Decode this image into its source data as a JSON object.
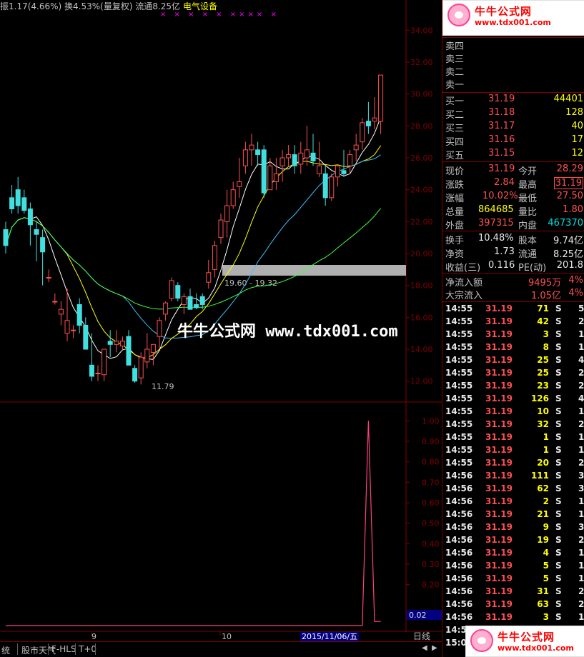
{
  "header": {
    "stats": "振1.17(4.66%) 换4.53%(量复权) 流通8.25亿",
    "sector": "电气设备",
    "markers": "× ×  × ×  × ××××  ×"
  },
  "price_axis": {
    "ticks": [
      "34.00",
      "32.00",
      "30.00",
      "28.00",
      "26.00",
      "24.00",
      "22.00",
      "20.00",
      "18.00",
      "16.00",
      "14.00",
      "12.00"
    ]
  },
  "annotations": {
    "range_label": "19.60 - 19.32",
    "low_label": "11.79"
  },
  "indicator_axis": {
    "ticks": [
      "1.00",
      "0.90",
      "0.80",
      "0.70",
      "0.60",
      "0.50",
      "0.40",
      "0.30",
      "0.20"
    ],
    "current_value": "0.02"
  },
  "time_axis": {
    "labels": [
      "9",
      "10"
    ],
    "cursor_date": "2015/11/06/五",
    "period": "日线"
  },
  "watermark": "牛牛公式网 www.tdx001.com",
  "logo": {
    "title": "牛牛公式网",
    "url": "www.tdx001.com",
    "faded_url": "www.0ogs.com"
  },
  "order_book": {
    "sells": [
      {
        "label": "卖四",
        "price": "",
        "vol": ""
      },
      {
        "label": "卖三",
        "price": "",
        "vol": ""
      },
      {
        "label": "卖二",
        "price": "",
        "vol": ""
      },
      {
        "label": "卖一",
        "price": "",
        "vol": ""
      }
    ],
    "buys": [
      {
        "label": "买一",
        "price": "31.19",
        "vol": "44401"
      },
      {
        "label": "买二",
        "price": "31.18",
        "vol": "128"
      },
      {
        "label": "买三",
        "price": "31.17",
        "vol": "40"
      },
      {
        "label": "买四",
        "price": "31.16",
        "vol": "17"
      },
      {
        "label": "买五",
        "price": "31.15",
        "vol": "12"
      }
    ]
  },
  "quote": {
    "current_label": "现价",
    "current": "31.19",
    "open_label": "今开",
    "open": "28.29",
    "change_label": "涨跌",
    "change": "2.84",
    "high_label": "最高",
    "high": "31.19",
    "pct_label": "涨幅",
    "pct": "10.02%",
    "low_label": "最低",
    "low": "27.50",
    "vol_label": "总量",
    "vol": "864685",
    "ratio_label": "量比",
    "ratio": "1.80",
    "out_label": "外盘",
    "out": "397315",
    "in_label": "内盘",
    "in": "467370",
    "turnover_label": "换手",
    "turnover": "10.48%",
    "capital_label": "股本",
    "capital": "9.74亿",
    "net_asset_label": "净资",
    "net_asset": "1.73",
    "float_label": "流通",
    "float": "8.25亿",
    "eps_label": "收益(三)",
    "eps": "0.116",
    "pe_label": "PE(动)",
    "pe": "201.8",
    "inflow_label": "净流入额",
    "inflow": "9495万",
    "inflow_pct": "4%",
    "block_label": "大宗流入",
    "block": "1.05亿",
    "block_pct": "4%"
  },
  "ticks": [
    {
      "time": "14:55",
      "price": "31.19",
      "vol": "71",
      "side": "S",
      "n": "5"
    },
    {
      "time": "14:55",
      "price": "31.19",
      "vol": "42",
      "side": "S",
      "n": "2"
    },
    {
      "time": "14:55",
      "price": "31.19",
      "vol": "3",
      "side": "S",
      "n": "1"
    },
    {
      "time": "14:55",
      "price": "31.19",
      "vol": "8",
      "side": "S",
      "n": "1"
    },
    {
      "time": "14:55",
      "price": "31.19",
      "vol": "25",
      "side": "S",
      "n": "4"
    },
    {
      "time": "14:55",
      "price": "31.19",
      "vol": "25",
      "side": "S",
      "n": "2"
    },
    {
      "time": "14:55",
      "price": "31.19",
      "vol": "23",
      "side": "S",
      "n": "2"
    },
    {
      "time": "14:55",
      "price": "31.19",
      "vol": "126",
      "side": "S",
      "n": "4"
    },
    {
      "time": "14:55",
      "price": "31.19",
      "vol": "10",
      "side": "S",
      "n": "1"
    },
    {
      "time": "14:55",
      "price": "31.19",
      "vol": "32",
      "side": "S",
      "n": "2"
    },
    {
      "time": "14:55",
      "price": "31.19",
      "vol": "1",
      "side": "S",
      "n": "1"
    },
    {
      "time": "14:55",
      "price": "31.19",
      "vol": "1",
      "side": "S",
      "n": "1"
    },
    {
      "time": "14:55",
      "price": "31.19",
      "vol": "20",
      "side": "S",
      "n": "2"
    },
    {
      "time": "14:56",
      "price": "31.19",
      "vol": "111",
      "side": "S",
      "n": "3"
    },
    {
      "time": "14:56",
      "price": "31.19",
      "vol": "62",
      "side": "S",
      "n": "3"
    },
    {
      "time": "14:56",
      "price": "31.19",
      "vol": "2",
      "side": "S",
      "n": "1"
    },
    {
      "time": "14:56",
      "price": "31.19",
      "vol": "21",
      "side": "S",
      "n": "1"
    },
    {
      "time": "14:56",
      "price": "31.19",
      "vol": "9",
      "side": "S",
      "n": "3"
    },
    {
      "time": "14:56",
      "price": "31.19",
      "vol": "19",
      "side": "S",
      "n": "2"
    },
    {
      "time": "14:56",
      "price": "31.19",
      "vol": "4",
      "side": "S",
      "n": "1"
    },
    {
      "time": "14:56",
      "price": "31.19",
      "vol": "5",
      "side": "S",
      "n": "1"
    },
    {
      "time": "14:56",
      "price": "31.19",
      "vol": "5",
      "side": "S",
      "n": "1"
    },
    {
      "time": "14:56",
      "price": "31.19",
      "vol": "31",
      "side": "S",
      "n": "2"
    },
    {
      "time": "14:56",
      "price": "31.19",
      "vol": "63",
      "side": "S",
      "n": "2"
    },
    {
      "time": "14:56",
      "price": "31.19",
      "vol": "3",
      "side": "S",
      "n": "1"
    },
    {
      "time": "14:5",
      "price": "",
      "vol": "",
      "side": "",
      "n": ""
    },
    {
      "time": "15:0",
      "price": "",
      "vol": "",
      "side": "",
      "n": ""
    }
  ],
  "bottom_tabs": [
    "统",
    "股市天气",
    "F-HLS",
    "T+0"
  ],
  "colors": {
    "up": "#ff5050",
    "down": "#40e0e0",
    "ma5": "#ffffff",
    "ma10": "#ffff00",
    "ma20": "#40c0ff",
    "ma60": "#40ff40",
    "border": "#800000"
  },
  "chart_data": {
    "type": "candlestick",
    "ylim": [
      11,
      35
    ],
    "candles": [
      [
        21.5,
        22.0,
        20.0,
        20.5
      ],
      [
        23.5,
        24.3,
        22.5,
        22.8
      ],
      [
        24.0,
        24.8,
        22.5,
        23.0
      ],
      [
        23.5,
        24.0,
        22.5,
        22.7
      ],
      [
        22.8,
        23.2,
        20.5,
        21.8
      ],
      [
        21.5,
        22.0,
        19.5,
        21.2
      ],
      [
        21.0,
        21.5,
        18.0,
        20.1
      ],
      [
        18.5,
        19.0,
        18.2,
        18.5
      ],
      [
        17.0,
        17.5,
        16.8,
        17.0
      ],
      [
        16.2,
        17.0,
        15.5,
        16.5
      ],
      [
        15.0,
        17.8,
        14.5,
        15.8
      ],
      [
        15.2,
        15.5,
        14.7,
        15.2
      ],
      [
        16.8,
        17.2,
        15.0,
        15.5
      ],
      [
        15.5,
        16.0,
        14.2,
        14.0
      ],
      [
        13.0,
        15.0,
        12.0,
        12.3
      ],
      [
        12.5,
        13.0,
        12.0,
        12.5
      ],
      [
        12.4,
        14.0,
        12.0,
        14.0
      ],
      [
        14.5,
        15.2,
        13.5,
        14.3
      ],
      [
        14.3,
        15.2,
        13.8,
        14.5
      ],
      [
        14.2,
        14.8,
        14.0,
        14.5
      ],
      [
        14.8,
        15.2,
        13.5,
        13.0
      ],
      [
        12.8,
        13.0,
        11.9,
        12.0
      ],
      [
        12.2,
        13.8,
        11.79,
        13.5
      ],
      [
        13.2,
        15.0,
        12.8,
        14.0
      ],
      [
        13.8,
        14.3,
        13.0,
        14.3
      ],
      [
        14.8,
        16.0,
        14.0,
        15.8
      ],
      [
        16.2,
        17.0,
        15.8,
        16.9
      ],
      [
        17.2,
        18.5,
        17.0,
        18.3
      ],
      [
        18.0,
        18.2,
        17.0,
        17.2
      ],
      [
        16.8,
        17.5,
        16.2,
        17.3
      ],
      [
        17.3,
        17.8,
        16.5,
        16.5
      ],
      [
        16.8,
        17.5,
        16.5,
        16.6
      ],
      [
        17.3,
        17.5,
        16.5,
        16.8
      ],
      [
        18.2,
        19.6,
        17.8,
        18.8
      ],
      [
        19.0,
        20.8,
        18.5,
        20.5
      ],
      [
        21.0,
        22.5,
        20.6,
        22.1
      ],
      [
        22.0,
        24.0,
        21.0,
        23.0
      ],
      [
        23.0,
        24.5,
        22.8,
        24.0
      ],
      [
        24.2,
        26.0,
        23.5,
        24.5
      ],
      [
        25.5,
        27.0,
        25.0,
        26.5
      ],
      [
        26.5,
        27.5,
        25.5,
        26.8
      ],
      [
        26.5,
        27.0,
        25.5,
        26.2
      ],
      [
        26.5,
        26.8,
        23.5,
        23.8
      ],
      [
        24.0,
        26.0,
        24.0,
        25.5
      ],
      [
        24.5,
        26.0,
        24.0,
        25.0
      ],
      [
        25.5,
        26.5,
        24.5,
        26.0
      ],
      [
        26.0,
        26.8,
        25.5,
        26.2
      ],
      [
        26.2,
        26.8,
        25.0,
        25.5
      ],
      [
        25.6,
        27.0,
        25.0,
        26.3
      ],
      [
        26.0,
        28.0,
        25.5,
        26.5
      ],
      [
        26.3,
        27.5,
        25.5,
        25.8
      ],
      [
        25.0,
        27.0,
        24.8,
        25.5
      ],
      [
        25.0,
        25.5,
        23.0,
        23.5
      ],
      [
        23.5,
        25.0,
        23.3,
        24.8
      ],
      [
        24.8,
        25.5,
        24.2,
        25.5
      ],
      [
        25.2,
        26.5,
        24.8,
        25.0
      ],
      [
        25.5,
        26.5,
        25.0,
        26.2
      ],
      [
        26.5,
        27.5,
        25.8,
        26.8
      ],
      [
        27.0,
        28.5,
        26.5,
        28.2
      ],
      [
        28.3,
        29.5,
        27.5,
        28.0
      ],
      [
        28.3,
        29.8,
        27.8,
        28.5
      ],
      [
        28.29,
        31.19,
        27.5,
        31.19
      ]
    ],
    "indicator": {
      "ylim": [
        0,
        1.05
      ],
      "values": [
        0,
        0,
        0,
        0,
        0,
        0,
        0,
        0,
        0,
        0,
        0,
        0,
        0,
        0,
        0,
        0,
        0,
        0,
        0,
        0,
        0,
        0,
        0,
        0,
        0,
        0,
        0,
        0,
        0,
        0,
        0,
        0,
        0,
        0,
        0,
        0,
        0,
        0,
        0,
        0,
        0,
        0,
        0,
        0,
        0,
        0,
        0,
        0,
        0,
        0,
        0,
        0,
        0,
        0,
        0,
        0,
        0,
        0,
        0,
        1.0,
        0.02,
        0.02
      ]
    }
  }
}
